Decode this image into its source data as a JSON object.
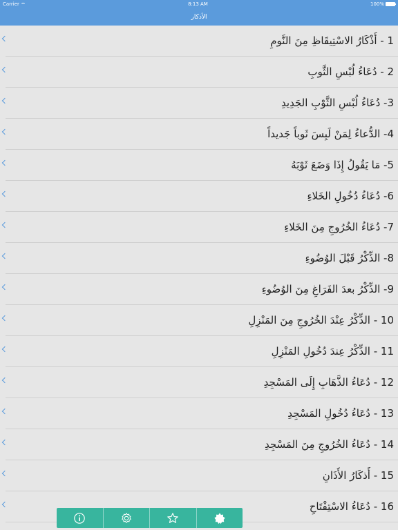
{
  "status": {
    "carrier": "Carrier",
    "time": "8:13 AM",
    "battery": "100%"
  },
  "nav": {
    "title": "الأذكار"
  },
  "items": [
    {
      "label": "1 - أَذْكَارُ الاسْتِيقَاظِ مِنَ النَّومِ"
    },
    {
      "label": "2 - دُعَاءُ لُبْسِ الثَّوبِ"
    },
    {
      "label": "3- دُعَاءُ لُبْسِ الثَّوْبِ الجَدِيدِ"
    },
    {
      "label": "4- الدُّعاءُ لِمَنْ لَبِسَ ثَوباً جَديداً"
    },
    {
      "label": "5- مَا يَقُولُ إِذَا وَضَعَ ثَوْبَهُ"
    },
    {
      "label": "6- دُعَاءُ دُخُولِ الخَلاءِ"
    },
    {
      "label": "7- دُعَاءُ الخُرُوجِ مِنَ الخَلاءِ"
    },
    {
      "label": "8- الذِّكْرُ قَبْلَ الوُضُوءِ"
    },
    {
      "label": "9- الذِّكْرُ بعدَ الفَرَاغِ مِنَ الوُضُوءِ"
    },
    {
      "label": "10 - الذِّكْرُ عِنْدَ الخُرُوجِ مِنَ المَنْزِلِ"
    },
    {
      "label": "11 - الذِّكْرُ عِندَ دُخُولِ المَنْزِلِ"
    },
    {
      "label": "12 - دُعَاءُ الذَّهَابِ إِلَى المَسْجِدِ"
    },
    {
      "label": "13 - دُعَاءُ دُخُولِ المَسْجِدِ"
    },
    {
      "label": "14 - دُعَاءُ الخُرُوجِ مِنَ المَسْجِدِ"
    },
    {
      "label": "15 - أَذكَارُ الأَذَانِ"
    },
    {
      "label": "16 - دُعَاءُ الاسْتِفْتَاحِ"
    }
  ],
  "tabbar": {
    "tabs": [
      {
        "icon": "info-icon"
      },
      {
        "icon": "settings-icon"
      },
      {
        "icon": "star-icon"
      },
      {
        "icon": "azkar-icon",
        "selected": true
      }
    ]
  },
  "colors": {
    "accent": "#5b9bdc",
    "tabbar": "#38b59e",
    "background": "#e6e6e6"
  }
}
